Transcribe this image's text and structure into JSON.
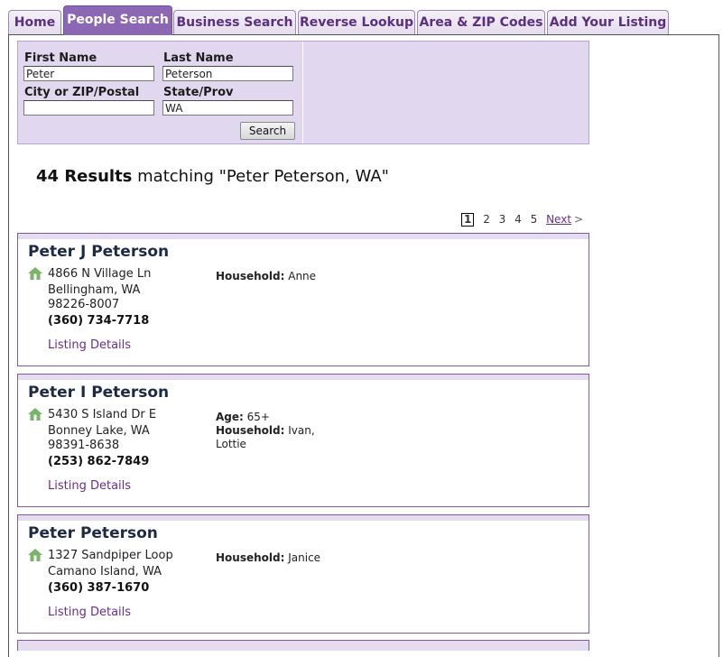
{
  "tabs": [
    {
      "label": "Home",
      "active": false
    },
    {
      "label": "People Search",
      "active": true
    },
    {
      "label": "Business Search",
      "active": false
    },
    {
      "label": "Reverse Lookup",
      "active": false
    },
    {
      "label": "Area & ZIP Codes",
      "active": false
    },
    {
      "label": "Add Your Listing",
      "active": false
    }
  ],
  "search": {
    "first_name_label": "First Name",
    "first_name_value": "Peter",
    "last_name_label": "Last Name",
    "last_name_value": "Peterson",
    "city_label": "City or ZIP/Postal",
    "city_value": "",
    "state_label": "State/Prov",
    "state_value": "WA",
    "button_label": "Search"
  },
  "results": {
    "count_label": "44 Results",
    "matching_text": "matching \"Peter Peterson, WA\""
  },
  "pagination": {
    "pages": [
      "1",
      "2",
      "3",
      "4",
      "5"
    ],
    "current": "1",
    "next_label": "Next",
    "next_arrow": ">"
  },
  "listings": [
    {
      "name": "Peter J Peterson",
      "street": "4866 N Village Ln",
      "city": "Bellingham, WA",
      "zip": "98226-8007",
      "phone": "(360) 734-7718",
      "details_label": "Listing Details",
      "age_label": "",
      "age": "",
      "household_label": "Household:",
      "household": "Anne"
    },
    {
      "name": "Peter I Peterson",
      "street": "5430 S Island Dr E",
      "city": "Bonney Lake, WA",
      "zip": "98391-8638",
      "phone": "(253) 862-7849",
      "details_label": "Listing Details",
      "age_label": "Age:",
      "age": "65+",
      "household_label": "Household:",
      "household": "Ivan, Lottie"
    },
    {
      "name": "Peter Peterson",
      "street": "1327 Sandpiper Loop",
      "city": "Camano Island, WA",
      "zip": "",
      "phone": "(360) 387-1670",
      "details_label": "Listing Details",
      "age_label": "",
      "age": "",
      "household_label": "Household:",
      "household": "Janice"
    }
  ],
  "colors": {
    "accent": "#8c67b4",
    "panel": "#e1d8ef",
    "link": "#6a2d8a",
    "house_icon": "#7ab36a"
  },
  "icons": {
    "listing_marker": "house-icon"
  }
}
